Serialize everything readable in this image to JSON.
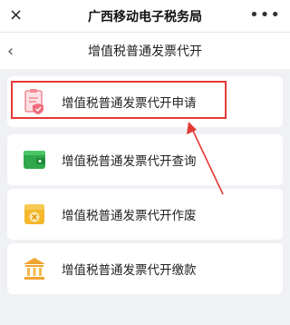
{
  "topbar": {
    "close_icon": "×",
    "title": "广西移动电子税务局",
    "more_icon": "•••"
  },
  "navbar": {
    "back_icon": "‹",
    "title": "增值税普通发票代开"
  },
  "menu": [
    {
      "label": "增值税普通发票代开申请",
      "icon": "form-shield-icon"
    },
    {
      "label": "增值税普通发票代开查询",
      "icon": "wallet-icon"
    },
    {
      "label": "增值税普通发票代开作废",
      "icon": "invoice-cancel-icon"
    },
    {
      "label": "增值税普通发票代开缴款",
      "icon": "bank-icon"
    }
  ],
  "colors": {
    "highlight": "#e53935",
    "background": "#f0f1f5"
  }
}
